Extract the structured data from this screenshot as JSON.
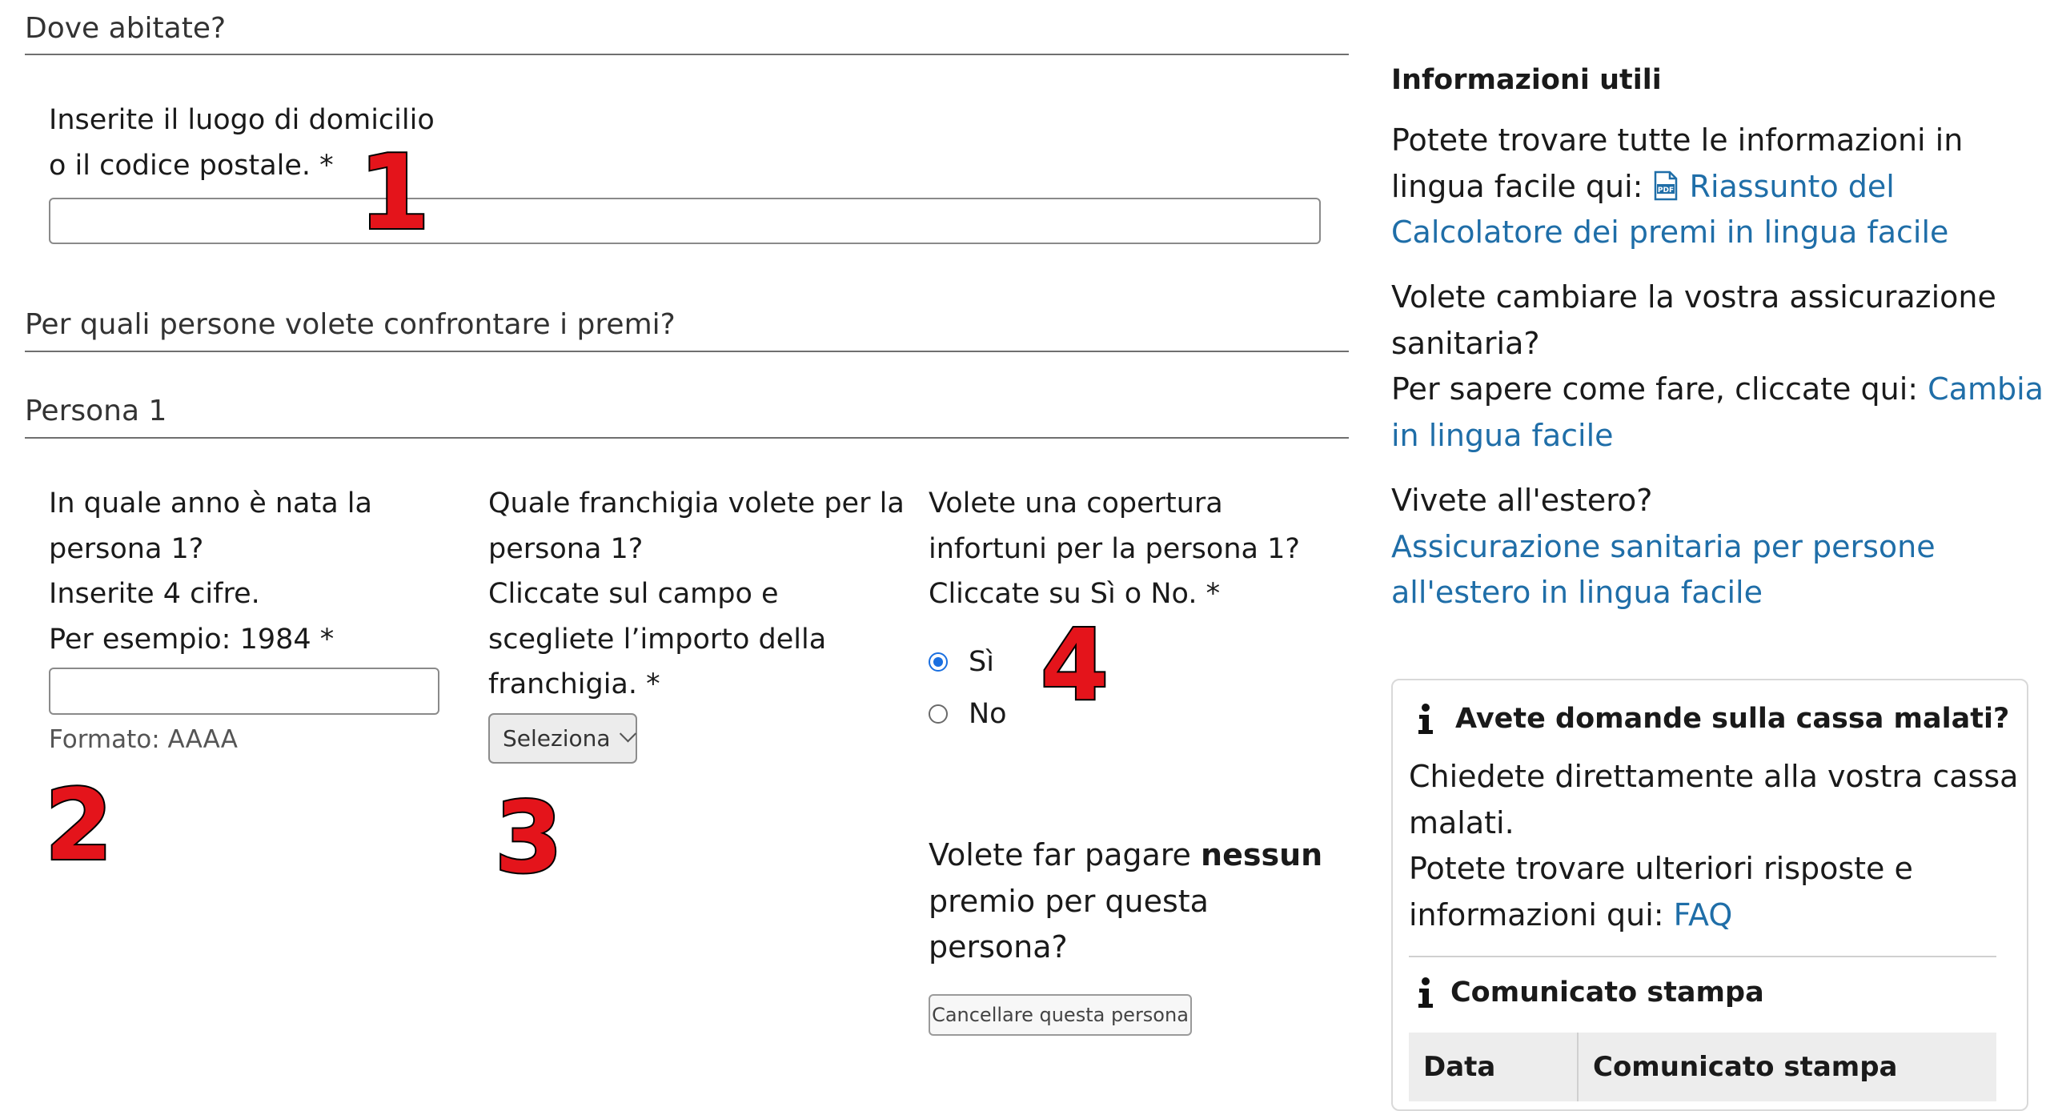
{
  "residence": {
    "heading": "Dove abitate?",
    "label_line1": "Inserite il luogo di domicilio",
    "label_line2": "o il codice postale. *",
    "value": ""
  },
  "persons": {
    "heading": "Per quali persone volete confrontare i premi?",
    "person1": {
      "heading": "Persona 1",
      "birth_year": {
        "line1": "In quale anno è nata la",
        "line2": "persona 1?",
        "line3": "Inserite 4 cifre.",
        "line4": "Per esempio: 1984 *",
        "value": "",
        "format_hint": "Formato: AAAA"
      },
      "franchise": {
        "line1": "Quale franchigia volete per la",
        "line2": "persona 1?",
        "line3": "Cliccate sul campo e",
        "line4": "scegliete l’importo della",
        "line5": "franchigia. *",
        "selected": "Seleziona"
      },
      "accident": {
        "line1": "Volete una copertura",
        "line2": "infortuni per la persona 1?",
        "line3": "Cliccate su Sì o No. *",
        "option_yes": "Sì",
        "option_no": "No",
        "selected": "Sì"
      },
      "no_premium": {
        "text_before": "Volete far pagare ",
        "text_bold": "nessun",
        "line2": "premio per questa",
        "line3": "persona?"
      },
      "delete_button": "Cancellare questa persona"
    }
  },
  "annotations": {
    "marker1": "1",
    "marker2": "2",
    "marker3": "3",
    "marker4": "4"
  },
  "sidebar": {
    "useful_info": {
      "title": "Informazioni utili",
      "line1": "Potete trovare tutte le informazioni in",
      "line2": "lingua facile qui: ",
      "pdf_icon": "pdf-icon",
      "pdf_link_part1": "Riassunto del",
      "pdf_link_part2": "Calcolatore dei premi in lingua facile"
    },
    "change_insurance": {
      "line1": "Volete cambiare la vostra assicurazione",
      "line2": "sanitaria?",
      "line3": "Per sapere come fare, cliccate qui: ",
      "link_part1": "Cambiare",
      "link_part2": "in lingua facile"
    },
    "abroad": {
      "line1": "Vivete all'estero?",
      "link_part1": "Assicurazione sanitaria per persone",
      "link_part2": "all'estero in lingua facile"
    },
    "questions_card": {
      "icon": "info-icon",
      "title": "Avete domande sulla cassa malati?",
      "line1": "Chiedete direttamente alla vostra cassa",
      "line2": "malati.",
      "line3": "Potete trovare ulteriori risposte e",
      "line4": "informazioni qui: ",
      "faq_link": "FAQ",
      "press_title": "Comunicato stampa",
      "table_headers": [
        "Data",
        "Comunicato stampa"
      ]
    }
  },
  "colors": {
    "link": "#1f6ea8",
    "radio_checked": "#1a6fe0",
    "marker_fill": "#e4141b"
  }
}
